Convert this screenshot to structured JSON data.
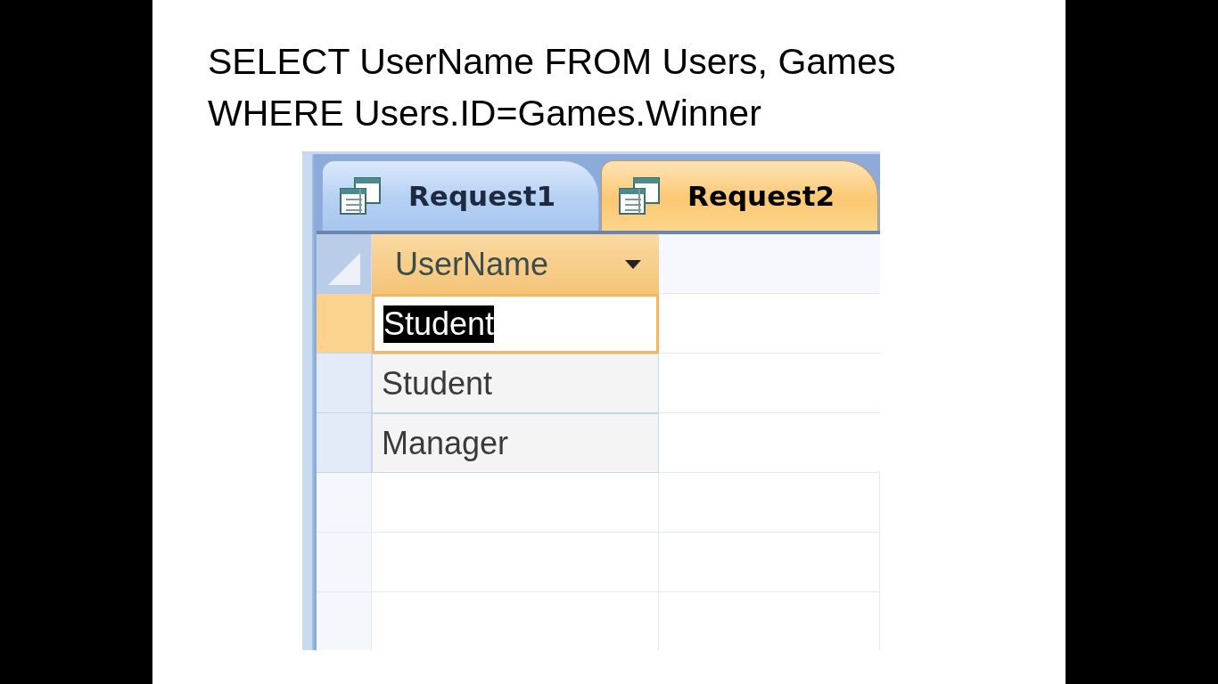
{
  "slide": {
    "query_lines": [
      "SELECT UserName FROM Users, Games",
      "WHERE Users.ID=Games.Winner"
    ]
  },
  "tabs": [
    {
      "label": "Request1",
      "selected": false
    },
    {
      "label": "Request2",
      "selected": true
    }
  ],
  "table": {
    "columns": [
      "UserName"
    ],
    "rows": [
      {
        "cells": [
          "Student"
        ],
        "selected": true
      },
      {
        "cells": [
          "Student"
        ],
        "selected": false
      },
      {
        "cells": [
          "Manager"
        ],
        "selected": false
      }
    ]
  }
}
